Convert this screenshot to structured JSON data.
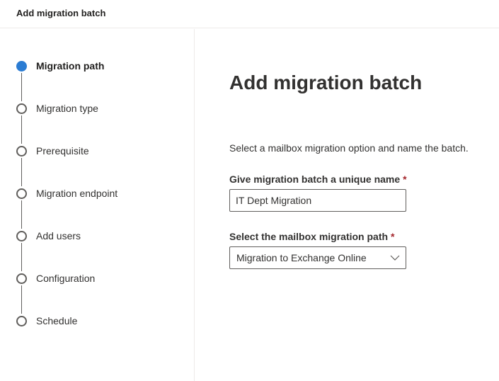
{
  "header": {
    "title": "Add migration batch"
  },
  "steps": [
    {
      "label": "Migration path",
      "state": "current"
    },
    {
      "label": "Migration type",
      "state": "pending"
    },
    {
      "label": "Prerequisite",
      "state": "pending"
    },
    {
      "label": "Migration endpoint",
      "state": "pending"
    },
    {
      "label": "Add users",
      "state": "pending"
    },
    {
      "label": "Configuration",
      "state": "pending"
    },
    {
      "label": "Schedule",
      "state": "pending"
    }
  ],
  "main": {
    "title": "Add migration batch",
    "description": "Select a mailbox migration option and name the batch.",
    "name_field": {
      "label": "Give migration batch a unique name",
      "required_marker": "*",
      "value": "IT Dept Migration"
    },
    "path_field": {
      "label": "Select the mailbox migration path",
      "required_marker": "*",
      "selected": "Migration to Exchange Online",
      "icon": "chevron-down-icon"
    }
  },
  "colors": {
    "accent": "#2b7cd3",
    "required": "#a4262c",
    "text": "#323130",
    "divider": "#edebe9"
  }
}
